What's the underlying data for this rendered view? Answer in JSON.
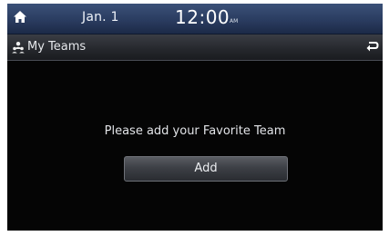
{
  "statusbar": {
    "home_icon": "home-icon",
    "date": "Jan. 1",
    "time": "12:00",
    "ampm": "AM"
  },
  "header": {
    "icon": "teams-icon",
    "title": "My Teams",
    "back_icon": "back-icon"
  },
  "main": {
    "message": "Please add your Favorite Team",
    "add_label": "Add"
  },
  "colors": {
    "statusbar_bg": "#2a3c60",
    "titlebar_bg": "#25272c",
    "screen_bg": "#050505",
    "text": "#e2e4e8"
  }
}
